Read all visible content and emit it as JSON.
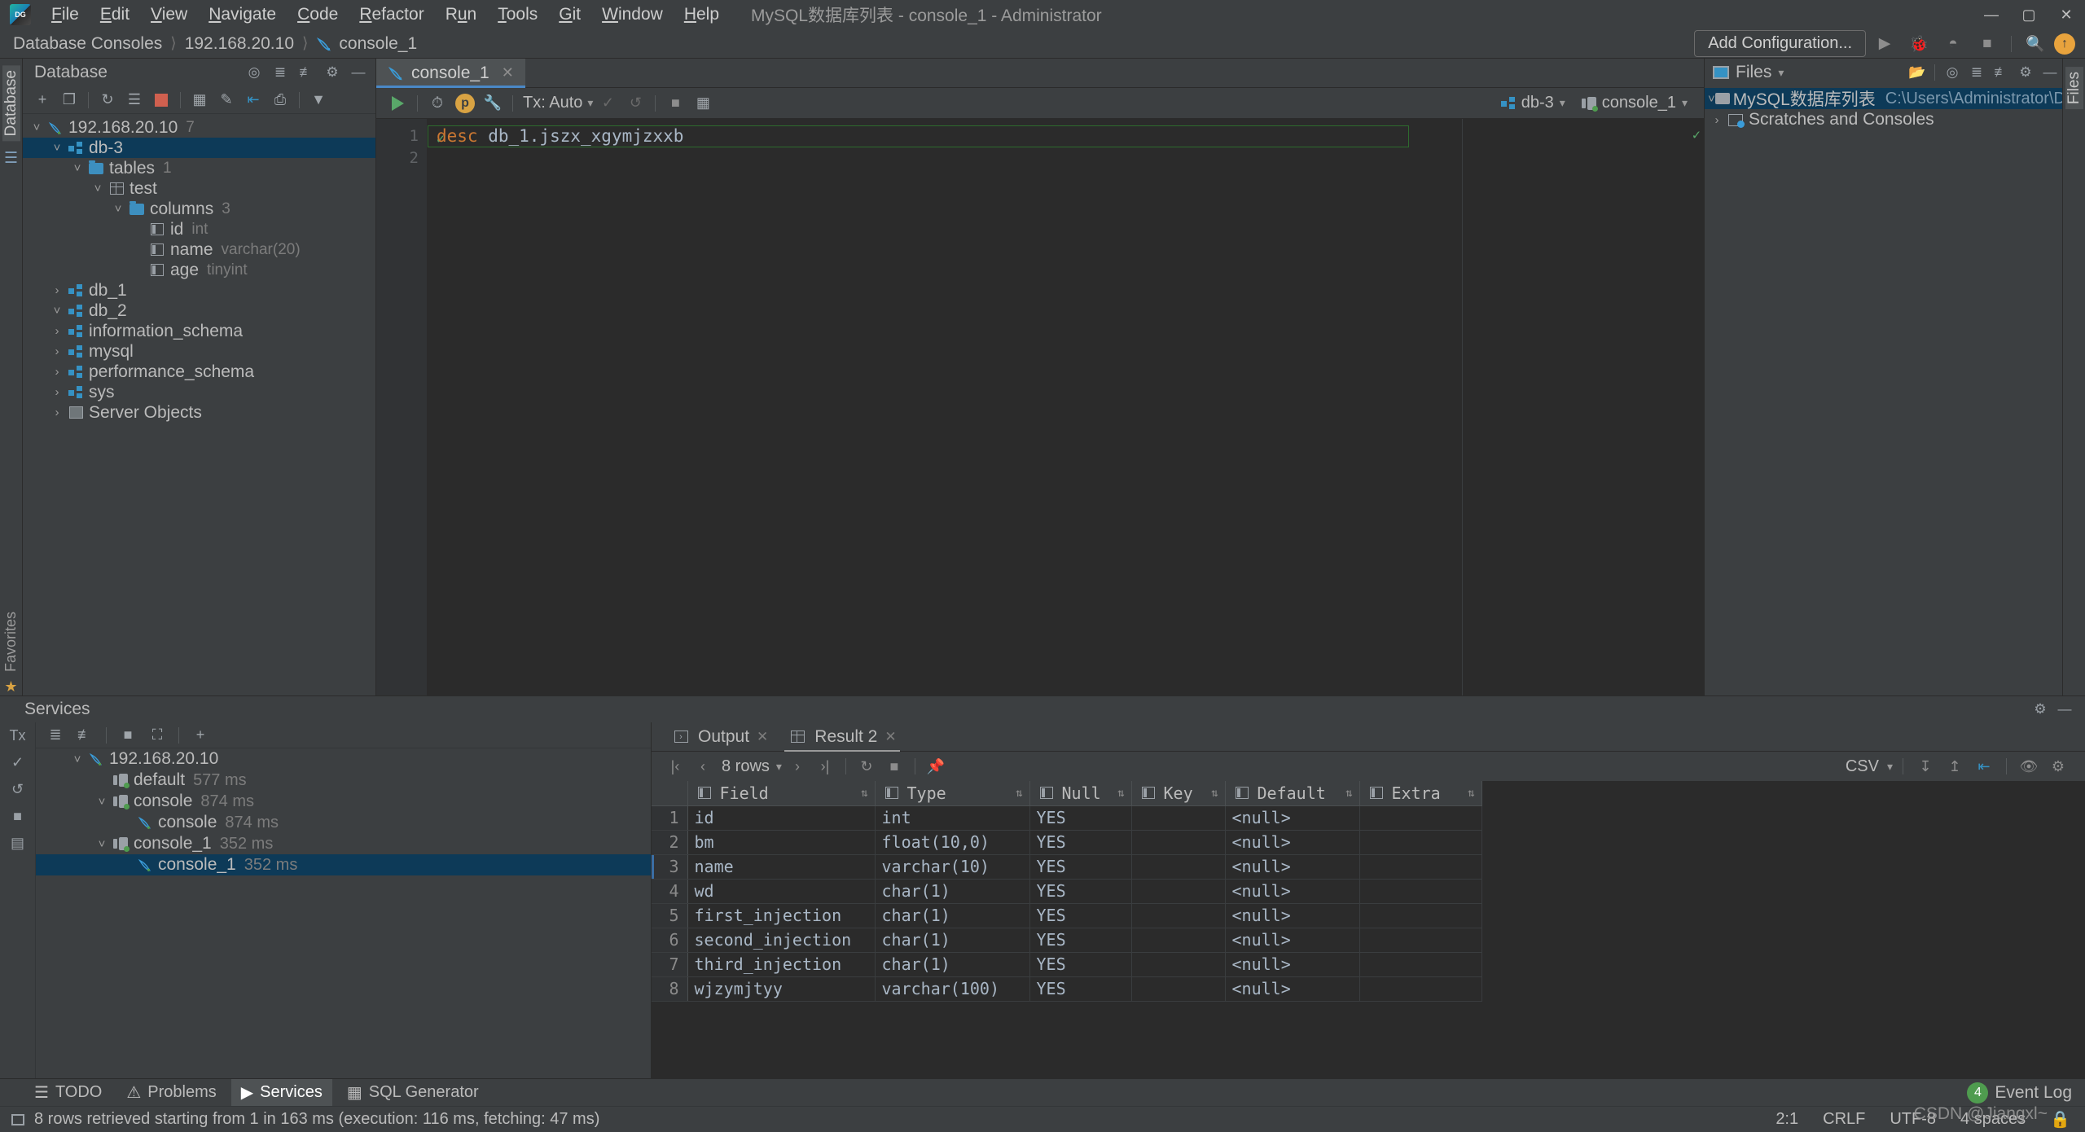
{
  "window": {
    "title": "MySQL数据库列表 - console_1 - Administrator",
    "menus": [
      "File",
      "Edit",
      "View",
      "Navigate",
      "Code",
      "Refactor",
      "Run",
      "Tools",
      "Git",
      "Window",
      "Help"
    ],
    "controls": {
      "minimize": "—",
      "maximize": "▢",
      "close": "✕"
    }
  },
  "navbar": {
    "breadcrumbs": [
      "Database Consoles",
      "192.168.20.10",
      "console_1"
    ],
    "add_configuration": "Add Configuration...",
    "update_badge": "↑"
  },
  "left_strip": {
    "database_label": "Database"
  },
  "database_panel": {
    "title": "Database",
    "tree": [
      {
        "indent": 0,
        "arrow": "v",
        "icon": "dolphin-icon",
        "label": "192.168.20.10",
        "dim": "7",
        "selected": false
      },
      {
        "indent": 1,
        "arrow": "v",
        "icon": "schema-icon",
        "label": "db-3",
        "dim": "",
        "selected": true
      },
      {
        "indent": 2,
        "arrow": "v",
        "icon": "folder-icon",
        "label": "tables",
        "dim": "1",
        "selected": false
      },
      {
        "indent": 3,
        "arrow": "v",
        "icon": "table-icon",
        "label": "test",
        "dim": "",
        "selected": false
      },
      {
        "indent": 4,
        "arrow": "v",
        "icon": "folder-icon",
        "label": "columns",
        "dim": "3",
        "selected": false
      },
      {
        "indent": 5,
        "arrow": "",
        "icon": "column-icon",
        "label": "id",
        "dim": "int",
        "selected": false
      },
      {
        "indent": 5,
        "arrow": "",
        "icon": "column-icon",
        "label": "name",
        "dim": "varchar(20)",
        "selected": false
      },
      {
        "indent": 5,
        "arrow": "",
        "icon": "column-icon",
        "label": "age",
        "dim": "tinyint",
        "selected": false
      },
      {
        "indent": 1,
        "arrow": ">",
        "icon": "schema-icon",
        "label": "db_1",
        "dim": "",
        "selected": false
      },
      {
        "indent": 1,
        "arrow": "v",
        "icon": "schema-icon",
        "label": "db_2",
        "dim": "",
        "selected": false
      },
      {
        "indent": 1,
        "arrow": ">",
        "icon": "schema-icon",
        "label": "information_schema",
        "dim": "",
        "selected": false
      },
      {
        "indent": 1,
        "arrow": ">",
        "icon": "schema-icon",
        "label": "mysql",
        "dim": "",
        "selected": false
      },
      {
        "indent": 1,
        "arrow": ">",
        "icon": "schema-icon",
        "label": "performance_schema",
        "dim": "",
        "selected": false
      },
      {
        "indent": 1,
        "arrow": ">",
        "icon": "schema-icon",
        "label": "sys",
        "dim": "",
        "selected": false
      },
      {
        "indent": 1,
        "arrow": ">",
        "icon": "server-objects-icon",
        "label": "Server Objects",
        "dim": "",
        "selected": false
      }
    ]
  },
  "editor": {
    "tab_label": "console_1",
    "tab_close": "✕",
    "toolbar": {
      "tx_label": "Tx: Auto"
    },
    "datasource_chip": "db-3",
    "session_chip": "console_1",
    "lines": [
      {
        "number": "1",
        "keyword": "desc",
        "rest": " db_1.jszx_xgymjzxxb"
      },
      {
        "number": "2",
        "keyword": "",
        "rest": ""
      }
    ]
  },
  "files_panel": {
    "title": "Files",
    "items": [
      {
        "arrow": "v",
        "label": "MySQL数据库列表",
        "path": "C:\\Users\\Administrator\\DataGripP",
        "selected": true
      },
      {
        "arrow": ">",
        "label": "Scratches and Consoles",
        "path": "",
        "selected": false
      }
    ],
    "side_label": "Files"
  },
  "services": {
    "title": "Services",
    "tx_label": "Tx",
    "tree": [
      {
        "indent": 0,
        "arrow": "v",
        "icon": "dolphin-icon",
        "label": "192.168.20.10",
        "ms": "",
        "selected": false
      },
      {
        "indent": 1,
        "arrow": "",
        "icon": "console-icon",
        "label": "default",
        "ms": "577 ms",
        "selected": false
      },
      {
        "indent": 1,
        "arrow": "v",
        "icon": "console-icon",
        "label": "console",
        "ms": "874 ms",
        "selected": false
      },
      {
        "indent": 2,
        "arrow": "",
        "icon": "dolphin-icon",
        "label": "console",
        "ms": "874 ms",
        "selected": false
      },
      {
        "indent": 1,
        "arrow": "v",
        "icon": "console-icon",
        "label": "console_1",
        "ms": "352 ms",
        "selected": false
      },
      {
        "indent": 2,
        "arrow": "",
        "icon": "dolphin-icon",
        "label": "console_1",
        "ms": "352 ms",
        "selected": true
      }
    ]
  },
  "results": {
    "tabs": [
      {
        "label": "Output",
        "icon": "output-icon",
        "active": false
      },
      {
        "label": "Result 2",
        "icon": "grid-icon",
        "active": true
      }
    ],
    "rows_label": "8 rows",
    "export_format": "CSV",
    "columns": [
      "Field",
      "Type",
      "Null",
      "Key",
      "Default",
      "Extra"
    ],
    "rows": [
      {
        "n": "1",
        "Field": "id",
        "Type": "int",
        "Null": "YES",
        "Key": "",
        "Default": "<null>",
        "Extra": ""
      },
      {
        "n": "2",
        "Field": "bm",
        "Type": "float(10,0)",
        "Null": "YES",
        "Key": "",
        "Default": "<null>",
        "Extra": ""
      },
      {
        "n": "3",
        "Field": "name",
        "Type": "varchar(10)",
        "Null": "YES",
        "Key": "",
        "Default": "<null>",
        "Extra": ""
      },
      {
        "n": "4",
        "Field": "wd",
        "Type": "char(1)",
        "Null": "YES",
        "Key": "",
        "Default": "<null>",
        "Extra": ""
      },
      {
        "n": "5",
        "Field": "first_injection",
        "Type": "char(1)",
        "Null": "YES",
        "Key": "",
        "Default": "<null>",
        "Extra": ""
      },
      {
        "n": "6",
        "Field": "second_injection",
        "Type": "char(1)",
        "Null": "YES",
        "Key": "",
        "Default": "<null>",
        "Extra": ""
      },
      {
        "n": "7",
        "Field": "third_injection",
        "Type": "char(1)",
        "Null": "YES",
        "Key": "",
        "Default": "<null>",
        "Extra": ""
      },
      {
        "n": "8",
        "Field": "wjzymjtyy",
        "Type": "varchar(100)",
        "Null": "YES",
        "Key": "",
        "Default": "<null>",
        "Extra": ""
      }
    ]
  },
  "tool_windows": {
    "buttons": [
      {
        "label": "TODO",
        "icon": "todo-icon",
        "active": false
      },
      {
        "label": "Problems",
        "icon": "problems-icon",
        "active": false
      },
      {
        "label": "Services",
        "icon": "services-icon",
        "active": true
      },
      {
        "label": "SQL Generator",
        "icon": "sql-generator-icon",
        "active": false
      }
    ],
    "event_log": "Event Log",
    "event_count": "4"
  },
  "status_bar": {
    "message": "8 rows retrieved starting from 1 in 163 ms (execution: 116 ms, fetching: 47 ms)",
    "caret": "2:1",
    "line_sep": "CRLF",
    "encoding": "UTF-8",
    "indent": "4 spaces",
    "watermark": "CSDN @Jiangxl~"
  },
  "favorites": {
    "label": "Favorites"
  },
  "colors": {
    "accent": "#3592c4",
    "selection": "#0d3a58",
    "run_green": "#59a869",
    "warn": "#d9a343"
  }
}
